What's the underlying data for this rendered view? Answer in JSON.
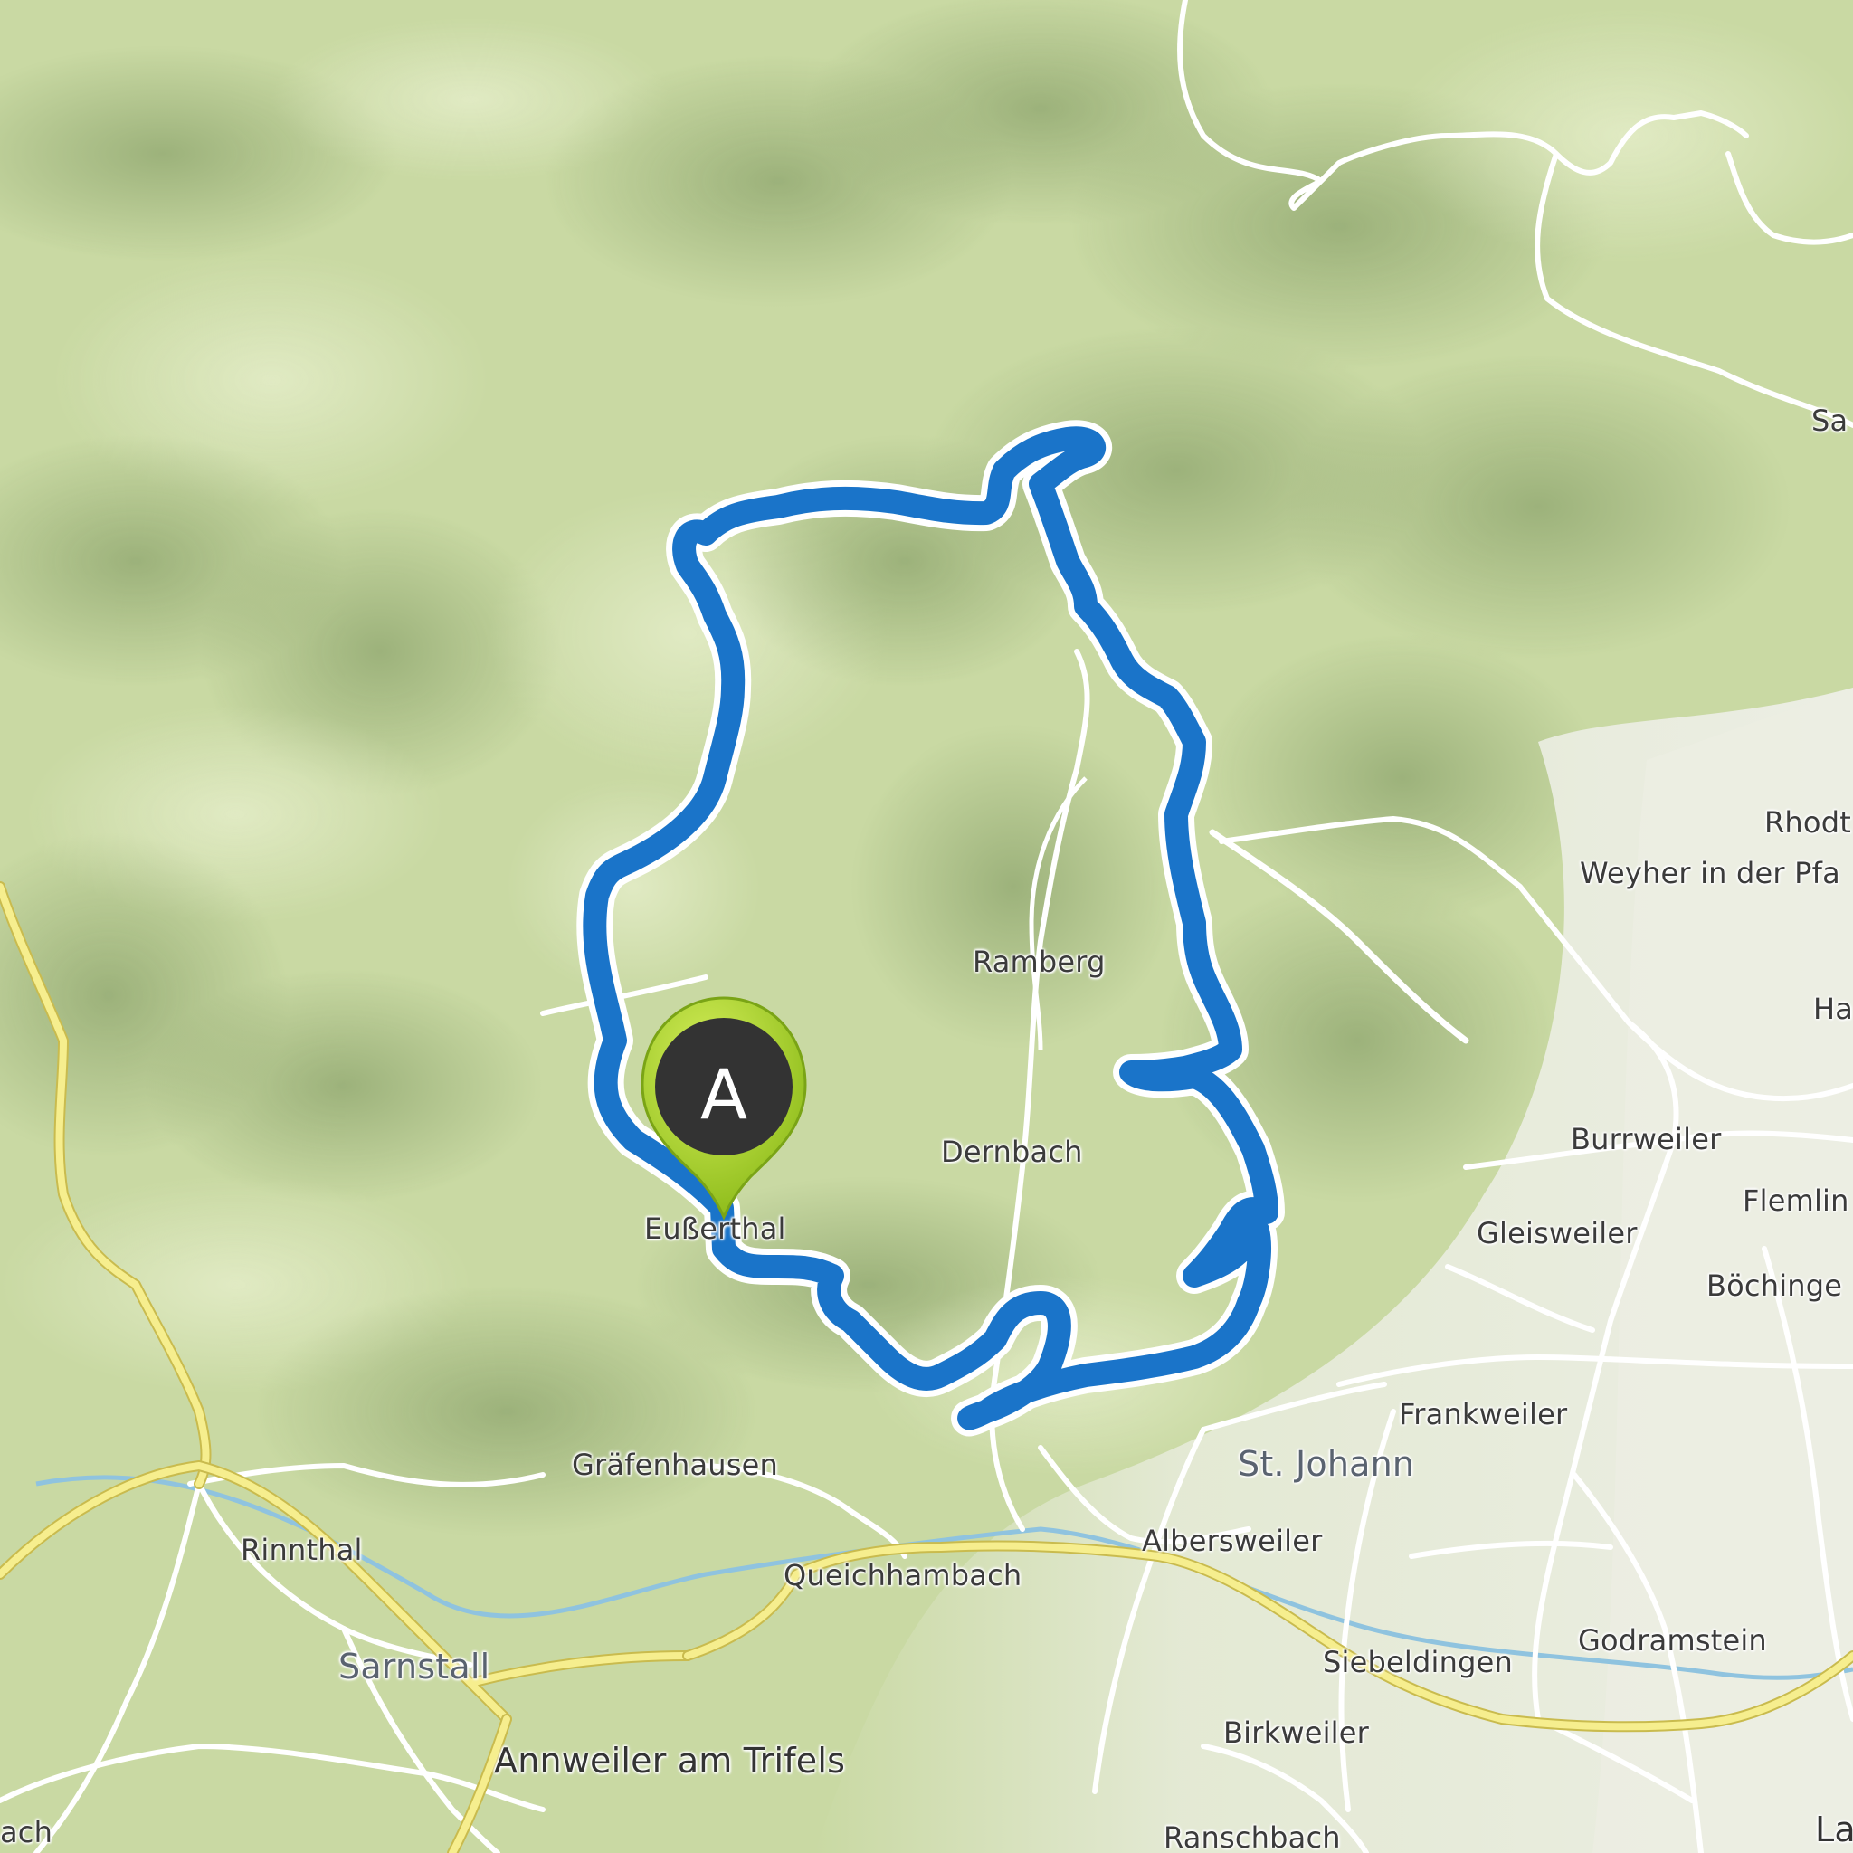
{
  "map": {
    "colors": {
      "land": "#c9d9a3",
      "forest_light": "#d6e3b0",
      "forest_shade": "#8fa66e",
      "lowland": "#e7ecda",
      "road": "#ffffff",
      "major_road": "#f6ee8e",
      "major_road_border": "#c9bb4e",
      "water": "#8fc3df",
      "route": "#1a74c9",
      "route_halo": "#ffffff",
      "marker_pin": "#a8d12b",
      "marker_center": "#333333"
    },
    "route_marker": {
      "label": "A",
      "icon": "map-pin-icon"
    },
    "places": {
      "ramberg": "Ramberg",
      "dernbach": "Dernbach",
      "euselthal": "Eußerthal",
      "graefenhausen": "Gräfenhausen",
      "rinnthal": "Rinnthal",
      "queichhambach": "Queichhambach",
      "sarnstall": "Sarnstall",
      "annweiler": "Annweiler am Trifels",
      "albersweiler": "Albersweiler",
      "st_johann": "St. Johann",
      "siebeldingen": "Siebeldingen",
      "birkweiler": "Birkweiler",
      "ranschbach": "Ranschbach",
      "godramstein": "Godramstein",
      "frankweiler": "Frankweiler",
      "gleisweiler": "Gleisweiler",
      "burrweiler": "Burrweiler",
      "boechingen": "Böchinge",
      "flemlingen": "Flemlin",
      "weyher": "Weyher in der Pfa",
      "rhodt": "Rhodt",
      "ha": "Ha",
      "sa": "Sa",
      "lan": "La",
      "bach": "ach"
    }
  }
}
